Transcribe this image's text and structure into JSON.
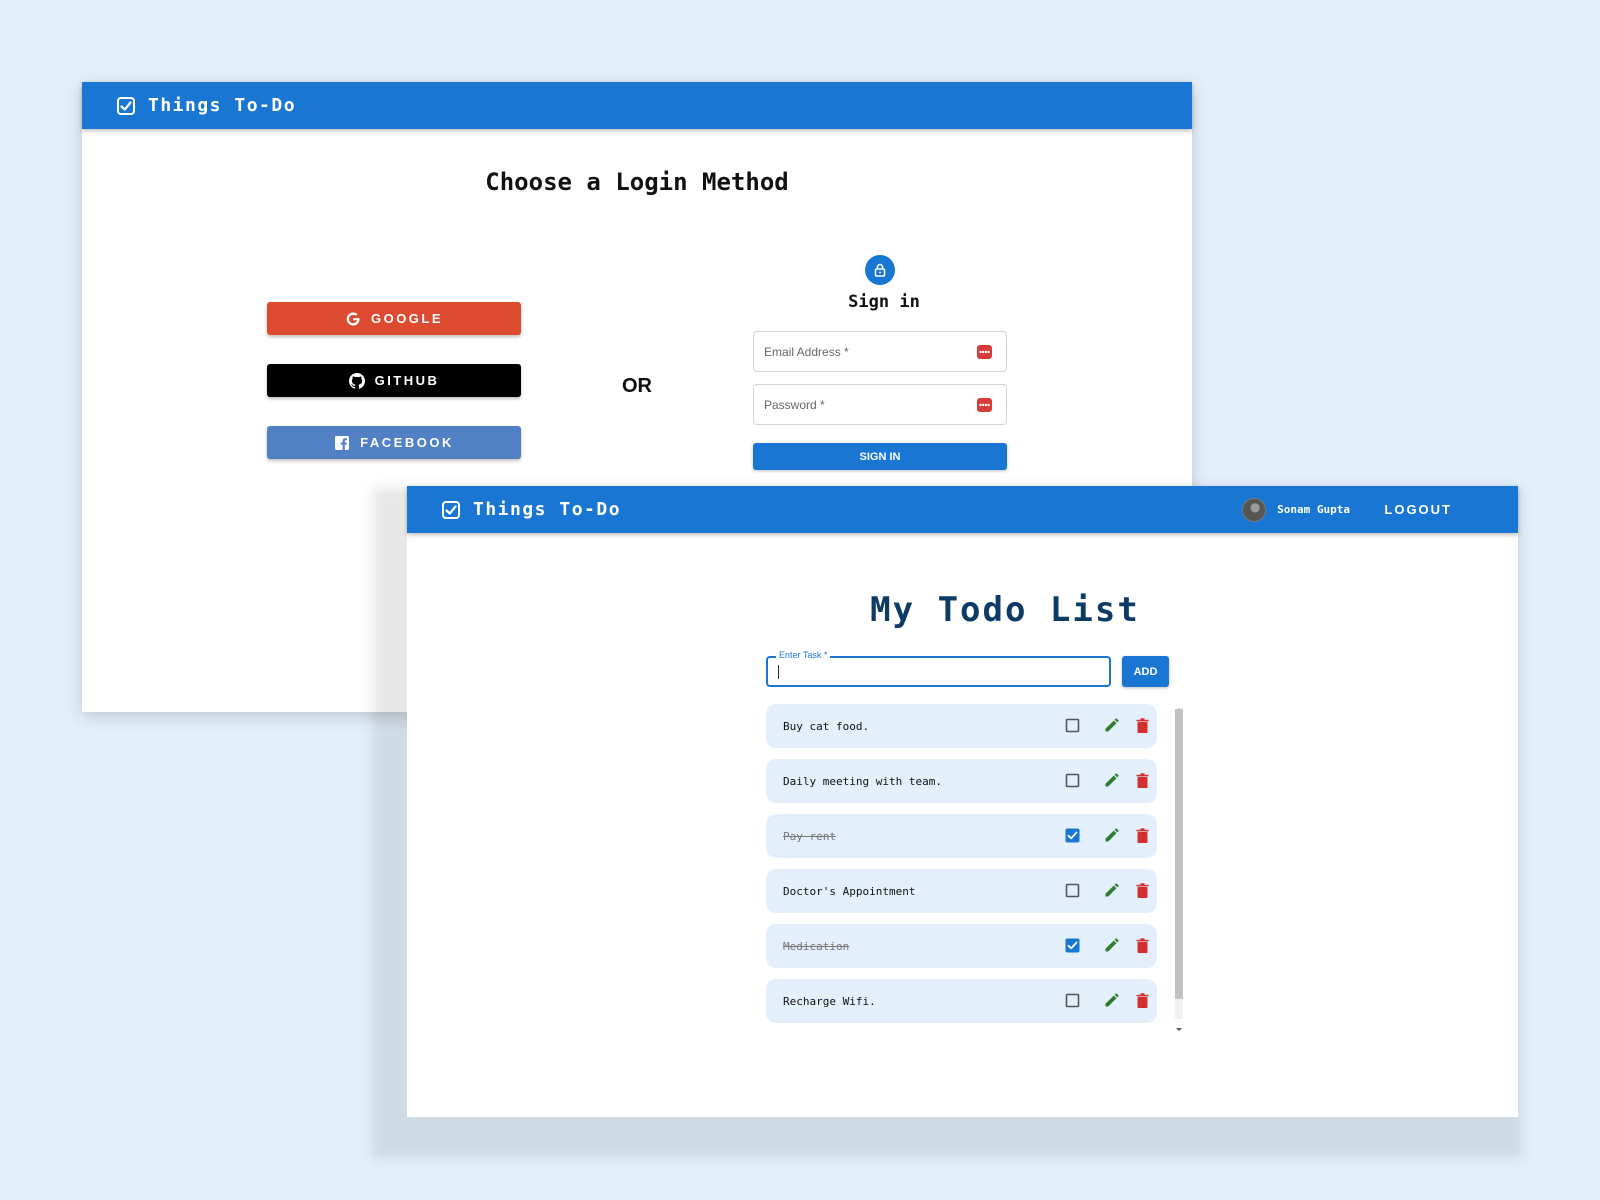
{
  "colors": {
    "background": "#e3f0fb",
    "appbar": "#1976d2",
    "google": "#dc4a30",
    "github": "#000000",
    "facebook": "#5180c5",
    "primary": "#1976d2",
    "heading_dark": "#0d3b66",
    "edit_icon": "#2e7d32",
    "delete_icon": "#d32f2f",
    "item_bg": "#e3f0fb"
  },
  "login_window": {
    "appbar": {
      "title": "Things To-Do",
      "icon": "checkbox-checked-icon"
    },
    "heading": "Choose a Login Method",
    "social_buttons": [
      {
        "label": "GOOGLE",
        "icon": "google-icon"
      },
      {
        "label": "GITHUB",
        "icon": "github-icon"
      },
      {
        "label": "FACEBOOK",
        "icon": "facebook-icon"
      }
    ],
    "or_label": "OR",
    "signin": {
      "icon": "lock-icon",
      "title": "Sign in",
      "email_placeholder": "Email Address *",
      "password_placeholder": "Password *",
      "field_badge_icon": "password-manager-icon",
      "button_label": "SIGN IN"
    }
  },
  "todo_window": {
    "appbar": {
      "title": "Things To-Do",
      "icon": "checkbox-checked-icon",
      "user_name": "Sonam Gupta",
      "logout_label": "LOGOUT"
    },
    "heading": "My Todo List",
    "task_input": {
      "label": "Enter Task *",
      "value": ""
    },
    "add_label": "ADD",
    "items": [
      {
        "text": "Buy cat food.",
        "done": false
      },
      {
        "text": "Daily meeting with team.",
        "done": false
      },
      {
        "text": "Pay rent",
        "done": true
      },
      {
        "text": "Doctor's Appointment",
        "done": false
      },
      {
        "text": "Medication",
        "done": true
      },
      {
        "text": "Recharge Wifi.",
        "done": false
      }
    ]
  }
}
